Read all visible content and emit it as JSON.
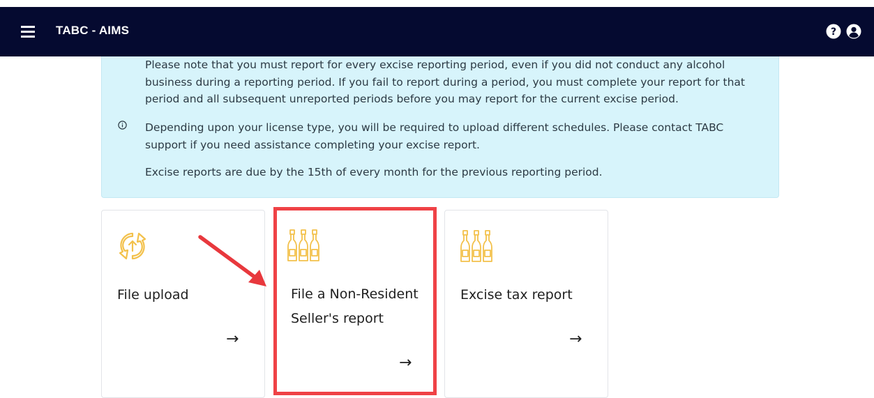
{
  "header": {
    "app_title": "TABC - AIMS",
    "menu_icon": "hamburger-menu-icon",
    "help_icon": "question-circle-icon",
    "user_icon": "user-circle-icon"
  },
  "notice": {
    "icon": "info-circle-icon",
    "paragraph_1": "Please note that you must report for every excise reporting period, even if you did not conduct any alcohol business during a reporting period. If you fail to report during a period, you must complete your report for that period and all subsequent unreported periods before you may report for the current excise period.",
    "paragraph_2": "Depending upon your license type, you will be required to upload different schedules. Please contact TABC support if you need assistance completing your excise report.",
    "paragraph_3": "Excise reports are due by the 15th of every month for the previous reporting period."
  },
  "cards": [
    {
      "title": "File upload",
      "icon": "sync-arrows-icon",
      "arrow": "→"
    },
    {
      "title": "File a Non-Resident Seller's report",
      "icon": "bottles-icon",
      "arrow": "→"
    },
    {
      "title": "Excise tax report",
      "icon": "bottles-icon",
      "arrow": "→"
    }
  ],
  "colors": {
    "topbar": "#050a30",
    "notice_bg": "#d7f4fb",
    "icon_accent": "#f3c14b",
    "highlight_border": "#ef4246",
    "annotation_arrow": "#e8383d"
  }
}
